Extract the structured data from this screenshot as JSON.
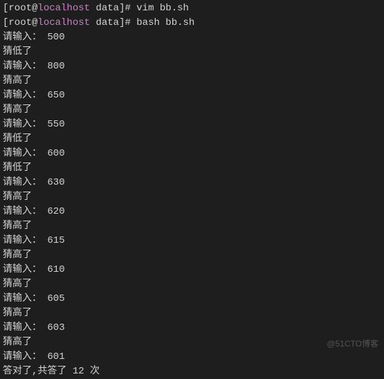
{
  "prompts": [
    {
      "user": "root",
      "host": "localhost",
      "path": "data",
      "command": "vim bb.sh"
    },
    {
      "user": "root",
      "host": "localhost",
      "path": "data",
      "command": "bash bb.sh"
    }
  ],
  "input_label": "请输入：",
  "feedback_low": "猜低了",
  "feedback_high": "猜高了",
  "guesses": [
    {
      "value": "500",
      "feedback": "猜低了"
    },
    {
      "value": "800",
      "feedback": "猜高了"
    },
    {
      "value": "650",
      "feedback": "猜高了"
    },
    {
      "value": "550",
      "feedback": "猜低了"
    },
    {
      "value": "600",
      "feedback": "猜低了"
    },
    {
      "value": "630",
      "feedback": "猜高了"
    },
    {
      "value": "620",
      "feedback": "猜高了"
    },
    {
      "value": "615",
      "feedback": "猜高了"
    },
    {
      "value": "610",
      "feedback": "猜高了"
    },
    {
      "value": "605",
      "feedback": "猜高了"
    },
    {
      "value": "603",
      "feedback": "猜高了"
    },
    {
      "value": "601",
      "feedback": null
    }
  ],
  "result_prefix": "答对了,共答了 ",
  "result_count": "12",
  "result_suffix": " 次",
  "watermark": "@51CTO博客"
}
